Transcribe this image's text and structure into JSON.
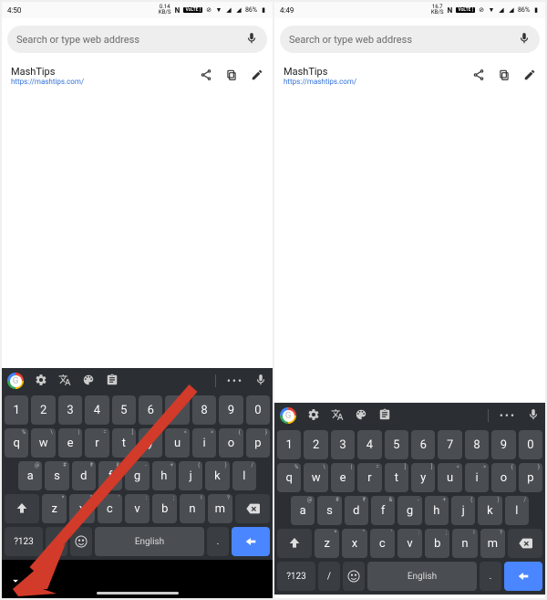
{
  "left": {
    "status": {
      "time": "4:50",
      "net_speed": "0.14",
      "net_unit": "KB/S",
      "battery": "86%"
    },
    "search_placeholder": "Search or type web address",
    "result": {
      "title": "MashTips",
      "url": "https://mashtips.com/"
    },
    "kb": {
      "row_num": [
        "1",
        "2",
        "3",
        "4",
        "5",
        "6",
        "7",
        "8",
        "9",
        "0"
      ],
      "row_q": [
        "q",
        "w",
        "e",
        "r",
        "t",
        "y",
        "u",
        "i",
        "o",
        "p"
      ],
      "hints_q": [
        "%",
        "\\",
        "|",
        "=",
        "[",
        "]",
        "<",
        ">",
        "{",
        "}"
      ],
      "row_a": [
        "a",
        "s",
        "d",
        "f",
        "g",
        "h",
        "j",
        "k",
        "l"
      ],
      "hints_a": [
        "@",
        "#",
        "₹",
        "&",
        "-",
        "+",
        "(",
        ")",
        "/"
      ],
      "row_z": [
        "z",
        "x",
        "c",
        "v",
        "b",
        "n",
        "m"
      ],
      "hints_z": [
        "*",
        "\"",
        "'",
        ":",
        ";",
        "!",
        "?"
      ],
      "fn_label": "?123",
      "slash": "/",
      "space_label": "English",
      "period": "."
    }
  },
  "right": {
    "status": {
      "time": "4:49",
      "net_speed": "16.7",
      "net_unit": "KB/S",
      "battery": "86%"
    },
    "search_placeholder": "Search or type web address",
    "result": {
      "title": "MashTips",
      "url": "https://mashtips.com/"
    },
    "kb": {
      "row_num": [
        "1",
        "2",
        "3",
        "4",
        "5",
        "6",
        "7",
        "8",
        "9",
        "0"
      ],
      "row_q": [
        "q",
        "w",
        "e",
        "r",
        "t",
        "y",
        "u",
        "i",
        "o",
        "p"
      ],
      "hints_q": [
        "%",
        "\\",
        "|",
        "=",
        "[",
        "]",
        "<",
        ">",
        "{",
        "}"
      ],
      "row_a": [
        "a",
        "s",
        "d",
        "f",
        "g",
        "h",
        "j",
        "k",
        "l"
      ],
      "hints_a": [
        "@",
        "#",
        "₹",
        "&",
        "-",
        "+",
        "(",
        ")",
        "/"
      ],
      "row_z": [
        "z",
        "x",
        "c",
        "v",
        "b",
        "n",
        "m"
      ],
      "hints_z": [
        "*",
        "\"",
        "'",
        ":",
        ";",
        "!",
        "?"
      ],
      "fn_label": "?123",
      "slash": "/",
      "space_label": "English",
      "period": "."
    }
  }
}
